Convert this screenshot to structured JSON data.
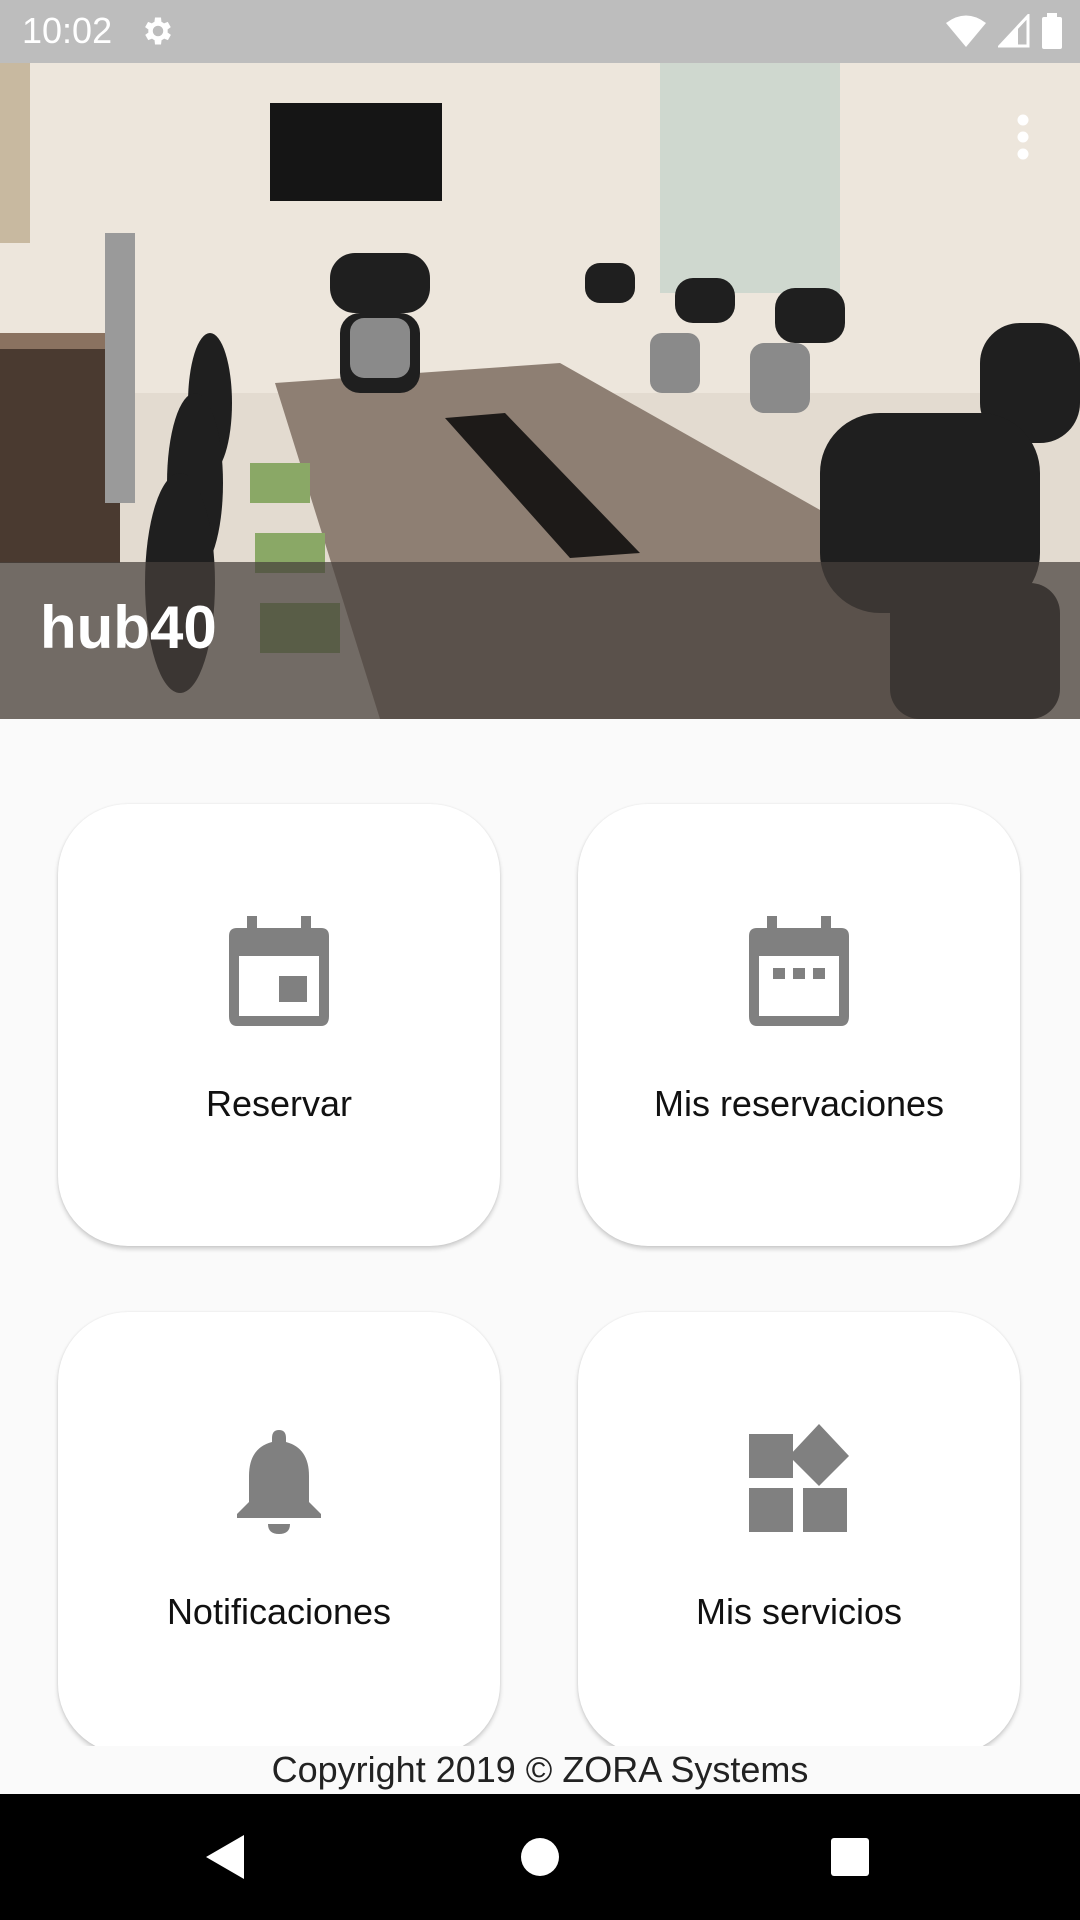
{
  "status_bar": {
    "time": "10:02"
  },
  "header": {
    "title": "hub40"
  },
  "cards": [
    {
      "label": "Reservar",
      "icon": "calendar-event-icon"
    },
    {
      "label": "Mis reservaciones",
      "icon": "calendar-dots-icon"
    },
    {
      "label": "Notificaciones",
      "icon": "bell-icon"
    },
    {
      "label": "Mis servicios",
      "icon": "widgets-icon"
    }
  ],
  "footer": {
    "copyright": "Copyright 2019 © ZORA Systems"
  },
  "colors": {
    "icon": "#808080",
    "status_bar": "#bdbdbd",
    "background": "#fafafa"
  }
}
